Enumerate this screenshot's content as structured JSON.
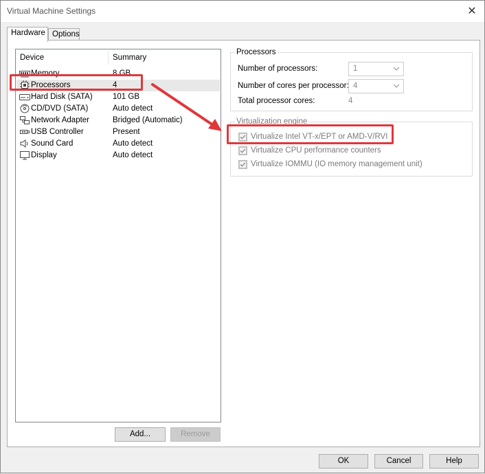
{
  "window": {
    "title": "Virtual Machine Settings",
    "close_glyph": "✕"
  },
  "tabs": [
    {
      "label": "Hardware",
      "active": true
    },
    {
      "label": "Options",
      "active": false
    }
  ],
  "device_list": {
    "columns": {
      "device": "Device",
      "summary": "Summary"
    },
    "rows": [
      {
        "name": "Memory",
        "summary": "8 GB",
        "icon": "memory-icon"
      },
      {
        "name": "Processors",
        "summary": "4",
        "icon": "processor-icon",
        "selected": true
      },
      {
        "name": "Hard Disk (SATA)",
        "summary": "101 GB",
        "icon": "hard-disk-icon"
      },
      {
        "name": "CD/DVD (SATA)",
        "summary": "Auto detect",
        "icon": "cd-dvd-icon"
      },
      {
        "name": "Network Adapter",
        "summary": "Bridged (Automatic)",
        "icon": "network-adapter-icon"
      },
      {
        "name": "USB Controller",
        "summary": "Present",
        "icon": "usb-icon"
      },
      {
        "name": "Sound Card",
        "summary": "Auto detect",
        "icon": "speaker-icon"
      },
      {
        "name": "Display",
        "summary": "Auto detect",
        "icon": "monitor-icon"
      }
    ],
    "add_label": "Add...",
    "remove_label": "Remove"
  },
  "processors": {
    "group_label": "Processors",
    "num_processors_label": "Number of processors:",
    "num_processors_value": "1",
    "cores_label": "Number of cores per processor:",
    "cores_value": "4",
    "total_label": "Total processor cores:",
    "total_value": "4"
  },
  "virtualization": {
    "group_label": "Virtualization engine",
    "options": [
      {
        "label": "Virtualize Intel VT-x/EPT or AMD-V/RVI",
        "checked": true
      },
      {
        "label": "Virtualize CPU performance counters",
        "checked": true
      },
      {
        "label": "Virtualize IOMMU (IO memory management unit)",
        "checked": true
      }
    ]
  },
  "footer": {
    "ok_label": "OK",
    "cancel_label": "Cancel",
    "help_label": "Help"
  },
  "colors": {
    "annotation": "#e0373b",
    "selection": "#e8e8e8"
  }
}
